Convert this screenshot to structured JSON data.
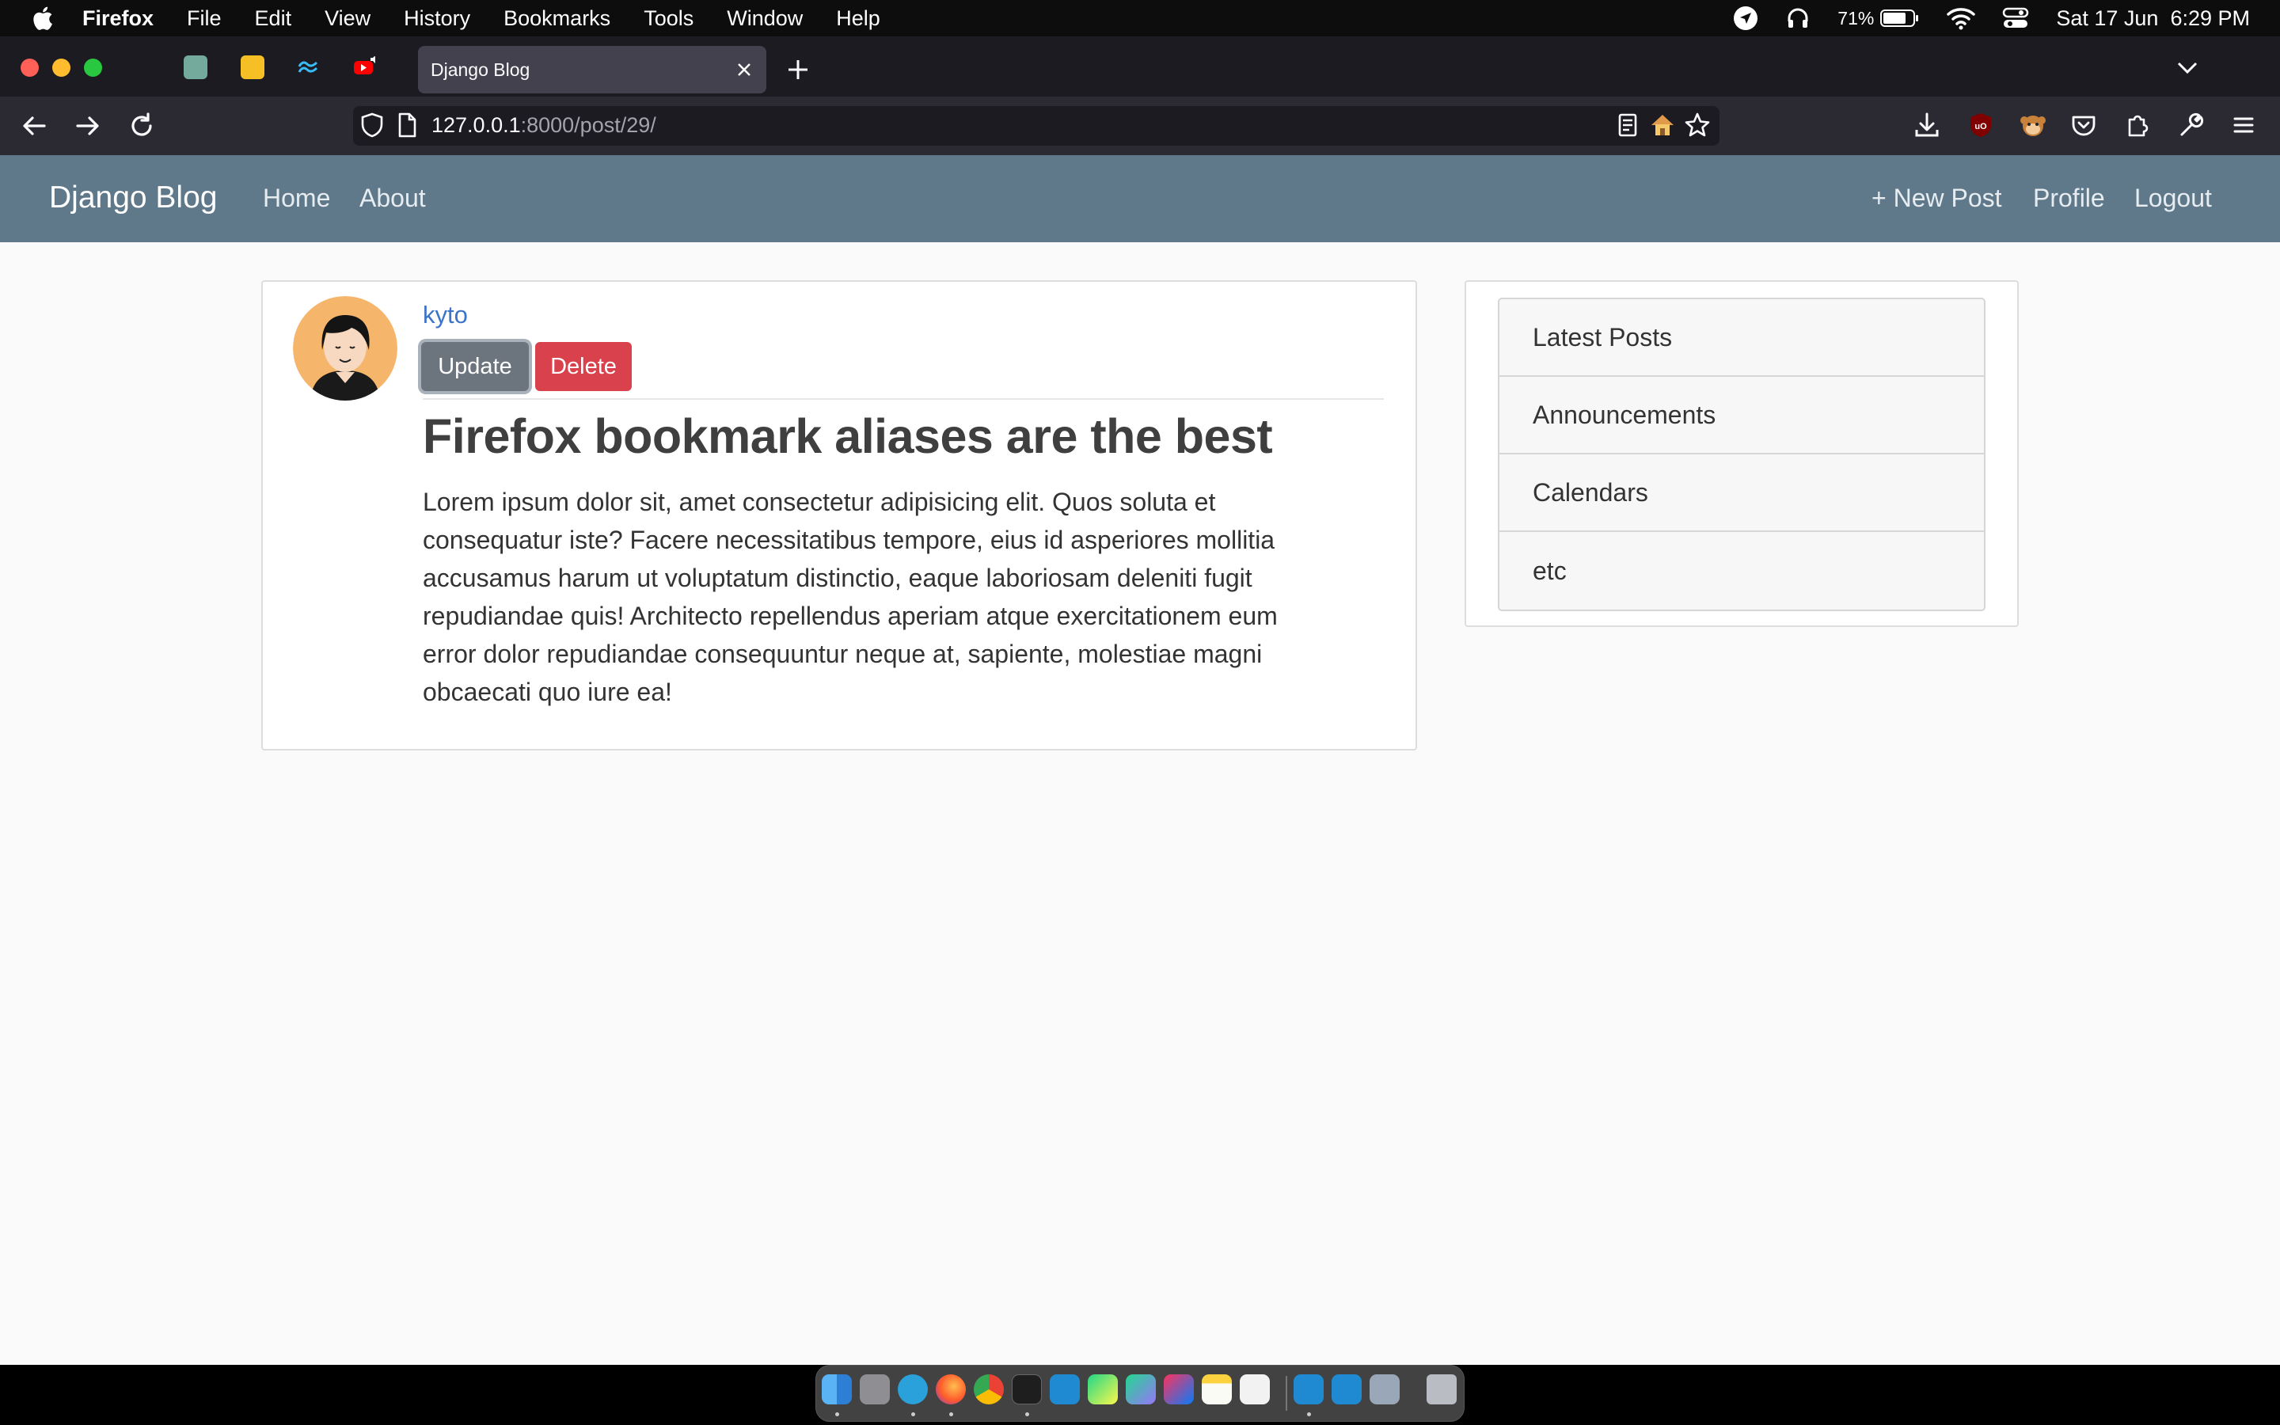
{
  "menubar": {
    "app_name": "Firefox",
    "items": [
      "File",
      "Edit",
      "View",
      "History",
      "Bookmarks",
      "Tools",
      "Window",
      "Help"
    ],
    "battery": "71%",
    "datetime": "Sat 17 Jun  6:29 PM"
  },
  "browser": {
    "active_tab_title": "Django Blog",
    "url_host": "127.0.0.1",
    "url_rest": ":8000/post/29/"
  },
  "site": {
    "brand": "Django Blog",
    "nav_left": [
      "Home",
      "About"
    ],
    "nav_right": [
      "+ New Post",
      "Profile",
      "Logout"
    ]
  },
  "post": {
    "author": "kyto",
    "update_label": "Update",
    "delete_label": "Delete",
    "title": "Firefox bookmark aliases are the best",
    "content_lines": [
      "Lorem ipsum dolor sit, amet consectetur adipisicing elit. Quos soluta et",
      "consequatur iste? Facere necessitatibus tempore, eius id asperiores mollitia",
      "accusamus harum ut voluptatum distinctio, eaque laboriosam deleniti fugit",
      "repudiandae quis! Architecto repellendus aperiam atque exercitationem eum",
      "error dolor repudiandae consequuntur neque at, sapiente, molestiae magni",
      "obcaecati quo iure ea!"
    ]
  },
  "sidebar": {
    "items": [
      "Latest Posts",
      "Announcements",
      "Calendars",
      "etc"
    ]
  },
  "colors": {
    "site_nav": "#5f788a",
    "author_link": "#3b74c8",
    "update_button": "#6c757d",
    "delete_button": "#d9414d"
  }
}
